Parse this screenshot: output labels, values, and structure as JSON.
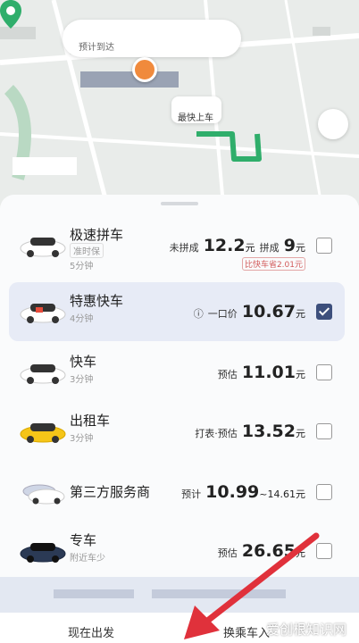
{
  "map": {
    "eta_label": "预计到达",
    "pickup_label": "最快上车"
  },
  "rides": [
    {
      "name": "极速拼车",
      "tag": "准时保",
      "eta": "5分钟",
      "price_prefix": "未拼成",
      "price": "12.2",
      "unit": "元",
      "price2_prefix": "拼成",
      "price2": "9",
      "unit2": "元",
      "discount": "比快车省2.01元",
      "checked": false
    },
    {
      "name": "特惠快车",
      "eta": "4分钟",
      "price_prefix": "一口价",
      "price": "10.67",
      "unit": "元",
      "checked": true
    },
    {
      "name": "快车",
      "eta": "3分钟",
      "price_prefix": "预估",
      "price": "11.01",
      "unit": "元",
      "checked": false
    },
    {
      "name": "出租车",
      "eta": "3分钟",
      "price_prefix": "打表·预估",
      "price": "13.52",
      "unit": "元",
      "checked": false
    },
    {
      "name": "第三方服务商",
      "price_prefix": "预计",
      "price": "10.99",
      "range_sep": "~14.61",
      "unit": "元",
      "checked": false
    },
    {
      "name": "专车",
      "eta": "附近车少",
      "price_prefix": "预估",
      "price": "26.65",
      "unit": "元",
      "checked": false
    }
  ],
  "bottom": {
    "depart_label": "现在出发",
    "switch_label": "换乘车入",
    "watermark": "爱创根知识网"
  },
  "colors": {
    "accent": "#3d4f7c",
    "route_green": "#2fae6b",
    "pin_orange": "#f08a3c"
  }
}
